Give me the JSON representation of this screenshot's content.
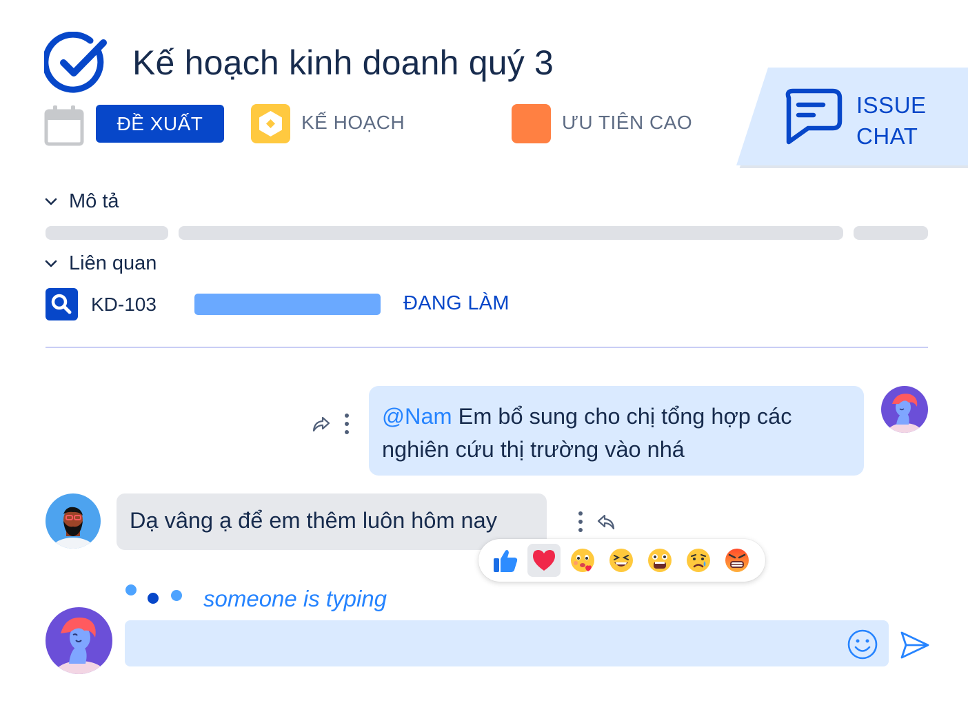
{
  "issue": {
    "title": "Kế hoạch kinh doanh quý 3",
    "status_label": "ĐỀ XUẤT",
    "type_label": "KẾ HOẠCH",
    "priority_label": "ƯU TIÊN CAO"
  },
  "badge": {
    "line1": "ISSUE",
    "line2": "CHAT"
  },
  "sections": {
    "description_label": "Mô tả",
    "related_label": "Liên quan"
  },
  "related_issue": {
    "key": "KD-103",
    "status": "ĐANG LÀM"
  },
  "chat": {
    "messages": [
      {
        "direction": "outgoing",
        "mention": "@Nam",
        "text": " Em bổ sung cho chị tổng hợp các nghiên cứu thị trường vào nhá"
      },
      {
        "direction": "incoming",
        "text": "Dạ vâng ạ để em thêm luôn hôm nay"
      }
    ],
    "reactions": [
      "thumbs-up",
      "heart",
      "kiss",
      "laughing",
      "shocked",
      "sad",
      "angry"
    ],
    "selected_reaction": "heart",
    "typing_text": "someone is typing",
    "input_value": ""
  },
  "icons": {
    "header": "check-circle-icon",
    "due_date": "calendar-icon",
    "issue_type": "plan-icon",
    "badge": "chat-bubble-icon",
    "related": "search-icon",
    "forward": "forward-icon",
    "more": "more-vertical-icon",
    "reply": "reply-icon",
    "emoji_picker": "smiley-icon",
    "send": "send-icon"
  },
  "colors": {
    "primary": "#0747c9",
    "accent": "#2684ff",
    "priority_high": "#ff8042",
    "type_icon": "#ffc940",
    "chat_bubble_out": "#daeaff",
    "chat_bubble_in": "#e6e8ec",
    "badge_bg": "#daeaff"
  }
}
